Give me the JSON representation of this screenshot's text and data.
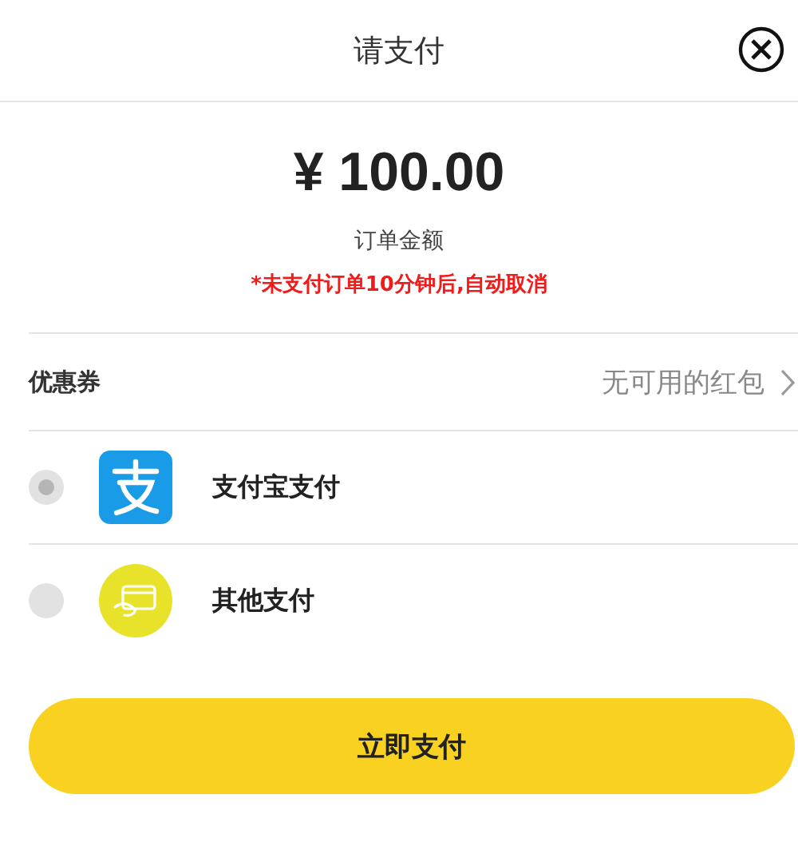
{
  "header": {
    "title": "请支付"
  },
  "order": {
    "amount": "¥ 100.00",
    "amount_label": "订单金额",
    "notice": "*未支付订单10分钟后,自动取消"
  },
  "coupon": {
    "label": "优惠券",
    "value": "无可用的红包"
  },
  "payment_methods": [
    {
      "kind": "alipay",
      "label": "支付宝支付",
      "selected": true
    },
    {
      "kind": "other",
      "label": "其他支付",
      "selected": false
    }
  ],
  "pay_button": "立即支付"
}
